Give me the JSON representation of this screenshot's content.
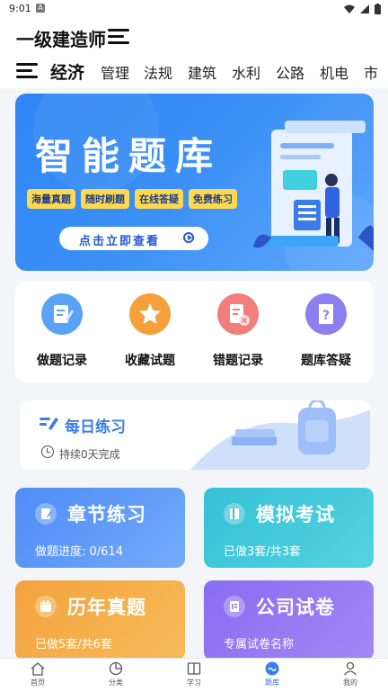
{
  "status_bar": {
    "time": "9:01",
    "notification": "A"
  },
  "app_bar": {
    "title": "一级建造师"
  },
  "tabs": [
    {
      "label": "经济",
      "active": true
    },
    {
      "label": "管理"
    },
    {
      "label": "法规"
    },
    {
      "label": "建筑"
    },
    {
      "label": "水利"
    },
    {
      "label": "公路"
    },
    {
      "label": "机电"
    },
    {
      "label": "市"
    }
  ],
  "banner": {
    "title": "智能题库",
    "chips": [
      "海量真题",
      "随时刷题",
      "在线答疑",
      "免费练习"
    ],
    "cta": "点击立即查看"
  },
  "quick_actions": [
    {
      "label": "做题记录",
      "icon": "edit-icon",
      "color": "#5aa2f5"
    },
    {
      "label": "收藏试题",
      "icon": "star-icon",
      "color": "#f6a03b"
    },
    {
      "label": "错题记录",
      "icon": "wrong-doc-icon",
      "color": "#f27d7d"
    },
    {
      "label": "题库答疑",
      "icon": "question-doc-icon",
      "color": "#8d7ff0"
    }
  ],
  "daily_practice": {
    "title": "每日练习",
    "subtitle": "持续0天完成"
  },
  "cards": [
    {
      "title": "章节练习",
      "subtitle": "做题进度: 0/614",
      "icon": "edit-icon",
      "color_from": "#4f8cf6",
      "color_to": "#74abfa"
    },
    {
      "title": "模拟考试",
      "subtitle": "已做3套/共3套",
      "icon": "book-icon",
      "color_from": "#35c0d6",
      "color_to": "#53d4e0"
    },
    {
      "title": "历年真题",
      "subtitle": "已做5套/共6套",
      "icon": "calendar-icon",
      "color_from": "#f3a33d",
      "color_to": "#f7bb5a"
    },
    {
      "title": "公司试卷",
      "subtitle": "专属试卷名称",
      "icon": "doc-icon",
      "color_from": "#8a6cf0",
      "color_to": "#a487f5"
    }
  ],
  "bottom_nav": [
    {
      "label": "首页",
      "icon": "home-icon"
    },
    {
      "label": "分类",
      "icon": "pie-icon"
    },
    {
      "label": "学习",
      "icon": "book-icon"
    },
    {
      "label": "题库",
      "icon": "quiz-icon",
      "active": true
    },
    {
      "label": "我的",
      "icon": "user-icon"
    }
  ],
  "colors": {
    "accent": "#2f86f4",
    "chip": "#ffd94d"
  }
}
